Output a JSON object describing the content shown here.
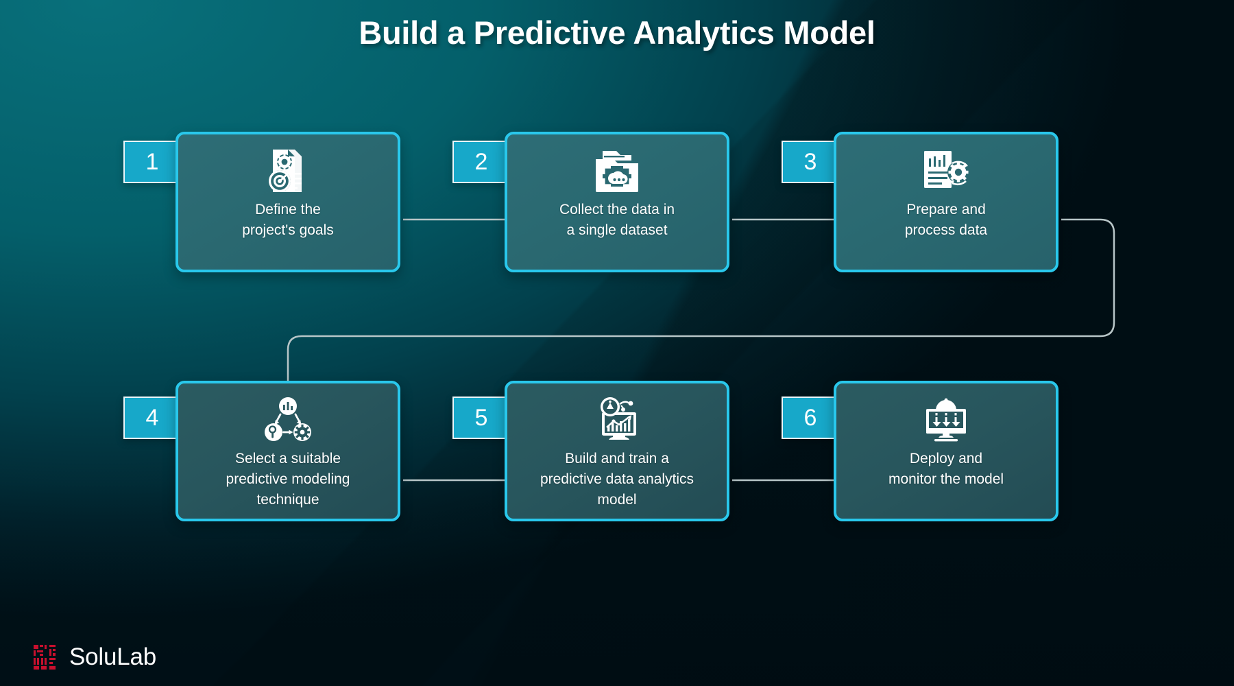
{
  "title": "Build a Predictive Analytics Model",
  "colors": {
    "background_top_left": "#03656f",
    "background_bottom_right": "#021a23",
    "card_border": "#29c8ec",
    "card_fill": "#2a6971",
    "card_fill_dark": "#28565d",
    "badge_fill": "#17a8c9",
    "badge_border": "#eaf7fb",
    "connector": "#b8c6c8",
    "text": "#ffffff",
    "logo_mark": "#c8102e"
  },
  "steps": [
    {
      "number": "1",
      "label": "Define the\nproject's goals",
      "icon": "document-gear-target-icon"
    },
    {
      "number": "2",
      "label": "Collect the data in\na single dataset",
      "icon": "folder-scan-cloud-icon"
    },
    {
      "number": "3",
      "label": "Prepare and\nprocess data",
      "icon": "document-chart-gear-icon"
    },
    {
      "number": "4",
      "label": "Select a suitable\npredictive modeling\ntechnique",
      "icon": "cycle-chart-search-gear-icon"
    },
    {
      "number": "5",
      "label": "Build and train a\npredictive data analytics\nmodel",
      "icon": "monitor-growth-chart-icon"
    },
    {
      "number": "6",
      "label": "Deploy and\nmonitor the model",
      "icon": "monitor-deploy-arrows-icon"
    }
  ],
  "branding": {
    "name": "SoluLab",
    "mark": "solulab-logo-icon"
  }
}
